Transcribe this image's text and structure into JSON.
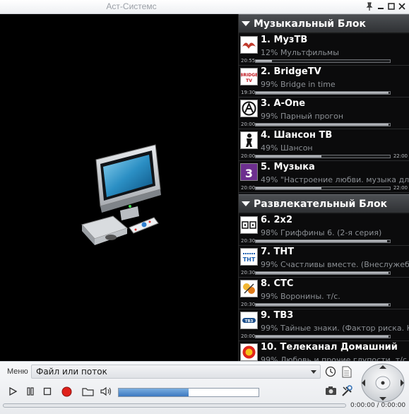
{
  "window": {
    "title": "Аст-Системс",
    "buttons": [
      "pin",
      "minimize",
      "maximize",
      "close"
    ]
  },
  "groups": [
    {
      "title": "Музыкальный Блок",
      "channels": [
        {
          "name": "1. МузТВ",
          "program": "12% Мультфильмы",
          "start": "20:55",
          "end": "",
          "progress": 0.12,
          "logo": "muztv-logo"
        },
        {
          "name": "2. BridgeTV",
          "program": "99% Bridge in time",
          "start": "19:30",
          "end": "",
          "progress": 0.99,
          "logo": "bridgetv-logo"
        },
        {
          "name": "3. A-One",
          "program": "99% Парный прогон",
          "start": "20:00",
          "end": "",
          "progress": 0.99,
          "logo": "aone-logo"
        },
        {
          "name": "4. Шансон ТВ",
          "program": "49% Шансон",
          "start": "20:00",
          "end": "22:00",
          "progress": 0.49,
          "logo": "shanson-logo"
        },
        {
          "name": "5. Музыка",
          "program": "49% \"Настроение любви. музыка для дво",
          "start": "20:00",
          "end": "22:00",
          "progress": 0.49,
          "logo": "muzyka-logo"
        }
      ]
    },
    {
      "title": "Развлекательный Блок",
      "channels": [
        {
          "name": "6. 2x2",
          "program": "98% Гриффины 6. (2-я серия)",
          "start": "20:30",
          "end": "",
          "progress": 0.98,
          "logo": "2x2-logo"
        },
        {
          "name": "7. ТНТ",
          "program": "99% Счастливы вместе. (Внеслужебный",
          "start": "20:30",
          "end": "",
          "progress": 0.99,
          "logo": "tnt-logo"
        },
        {
          "name": "8. СТС",
          "program": "99% Воронины. т/с.",
          "start": "20:30",
          "end": "",
          "progress": 0.99,
          "logo": "sts-logo"
        },
        {
          "name": "9. ТВ3",
          "program": "99% Тайные знаки. (Фактор риска. Космо",
          "start": "20:00",
          "end": "",
          "progress": 0.99,
          "logo": "tv3-logo"
        },
        {
          "name": "10. Телеканал Домашний",
          "program": "99% Любовь и прочие глупости. т/с",
          "start": "",
          "end": "",
          "progress": 0.99,
          "logo": "domashniy-logo"
        }
      ]
    }
  ],
  "controls": {
    "menu_label": "Меню",
    "source_value": "Файл или поток",
    "volume": 0.5,
    "seek": 0.0,
    "time": "0:00:00 / 0:00:00"
  },
  "colors": {
    "panel_bg": "#111214",
    "header_bg": "#3a3d41",
    "accent_blue": "#3d79c0"
  }
}
